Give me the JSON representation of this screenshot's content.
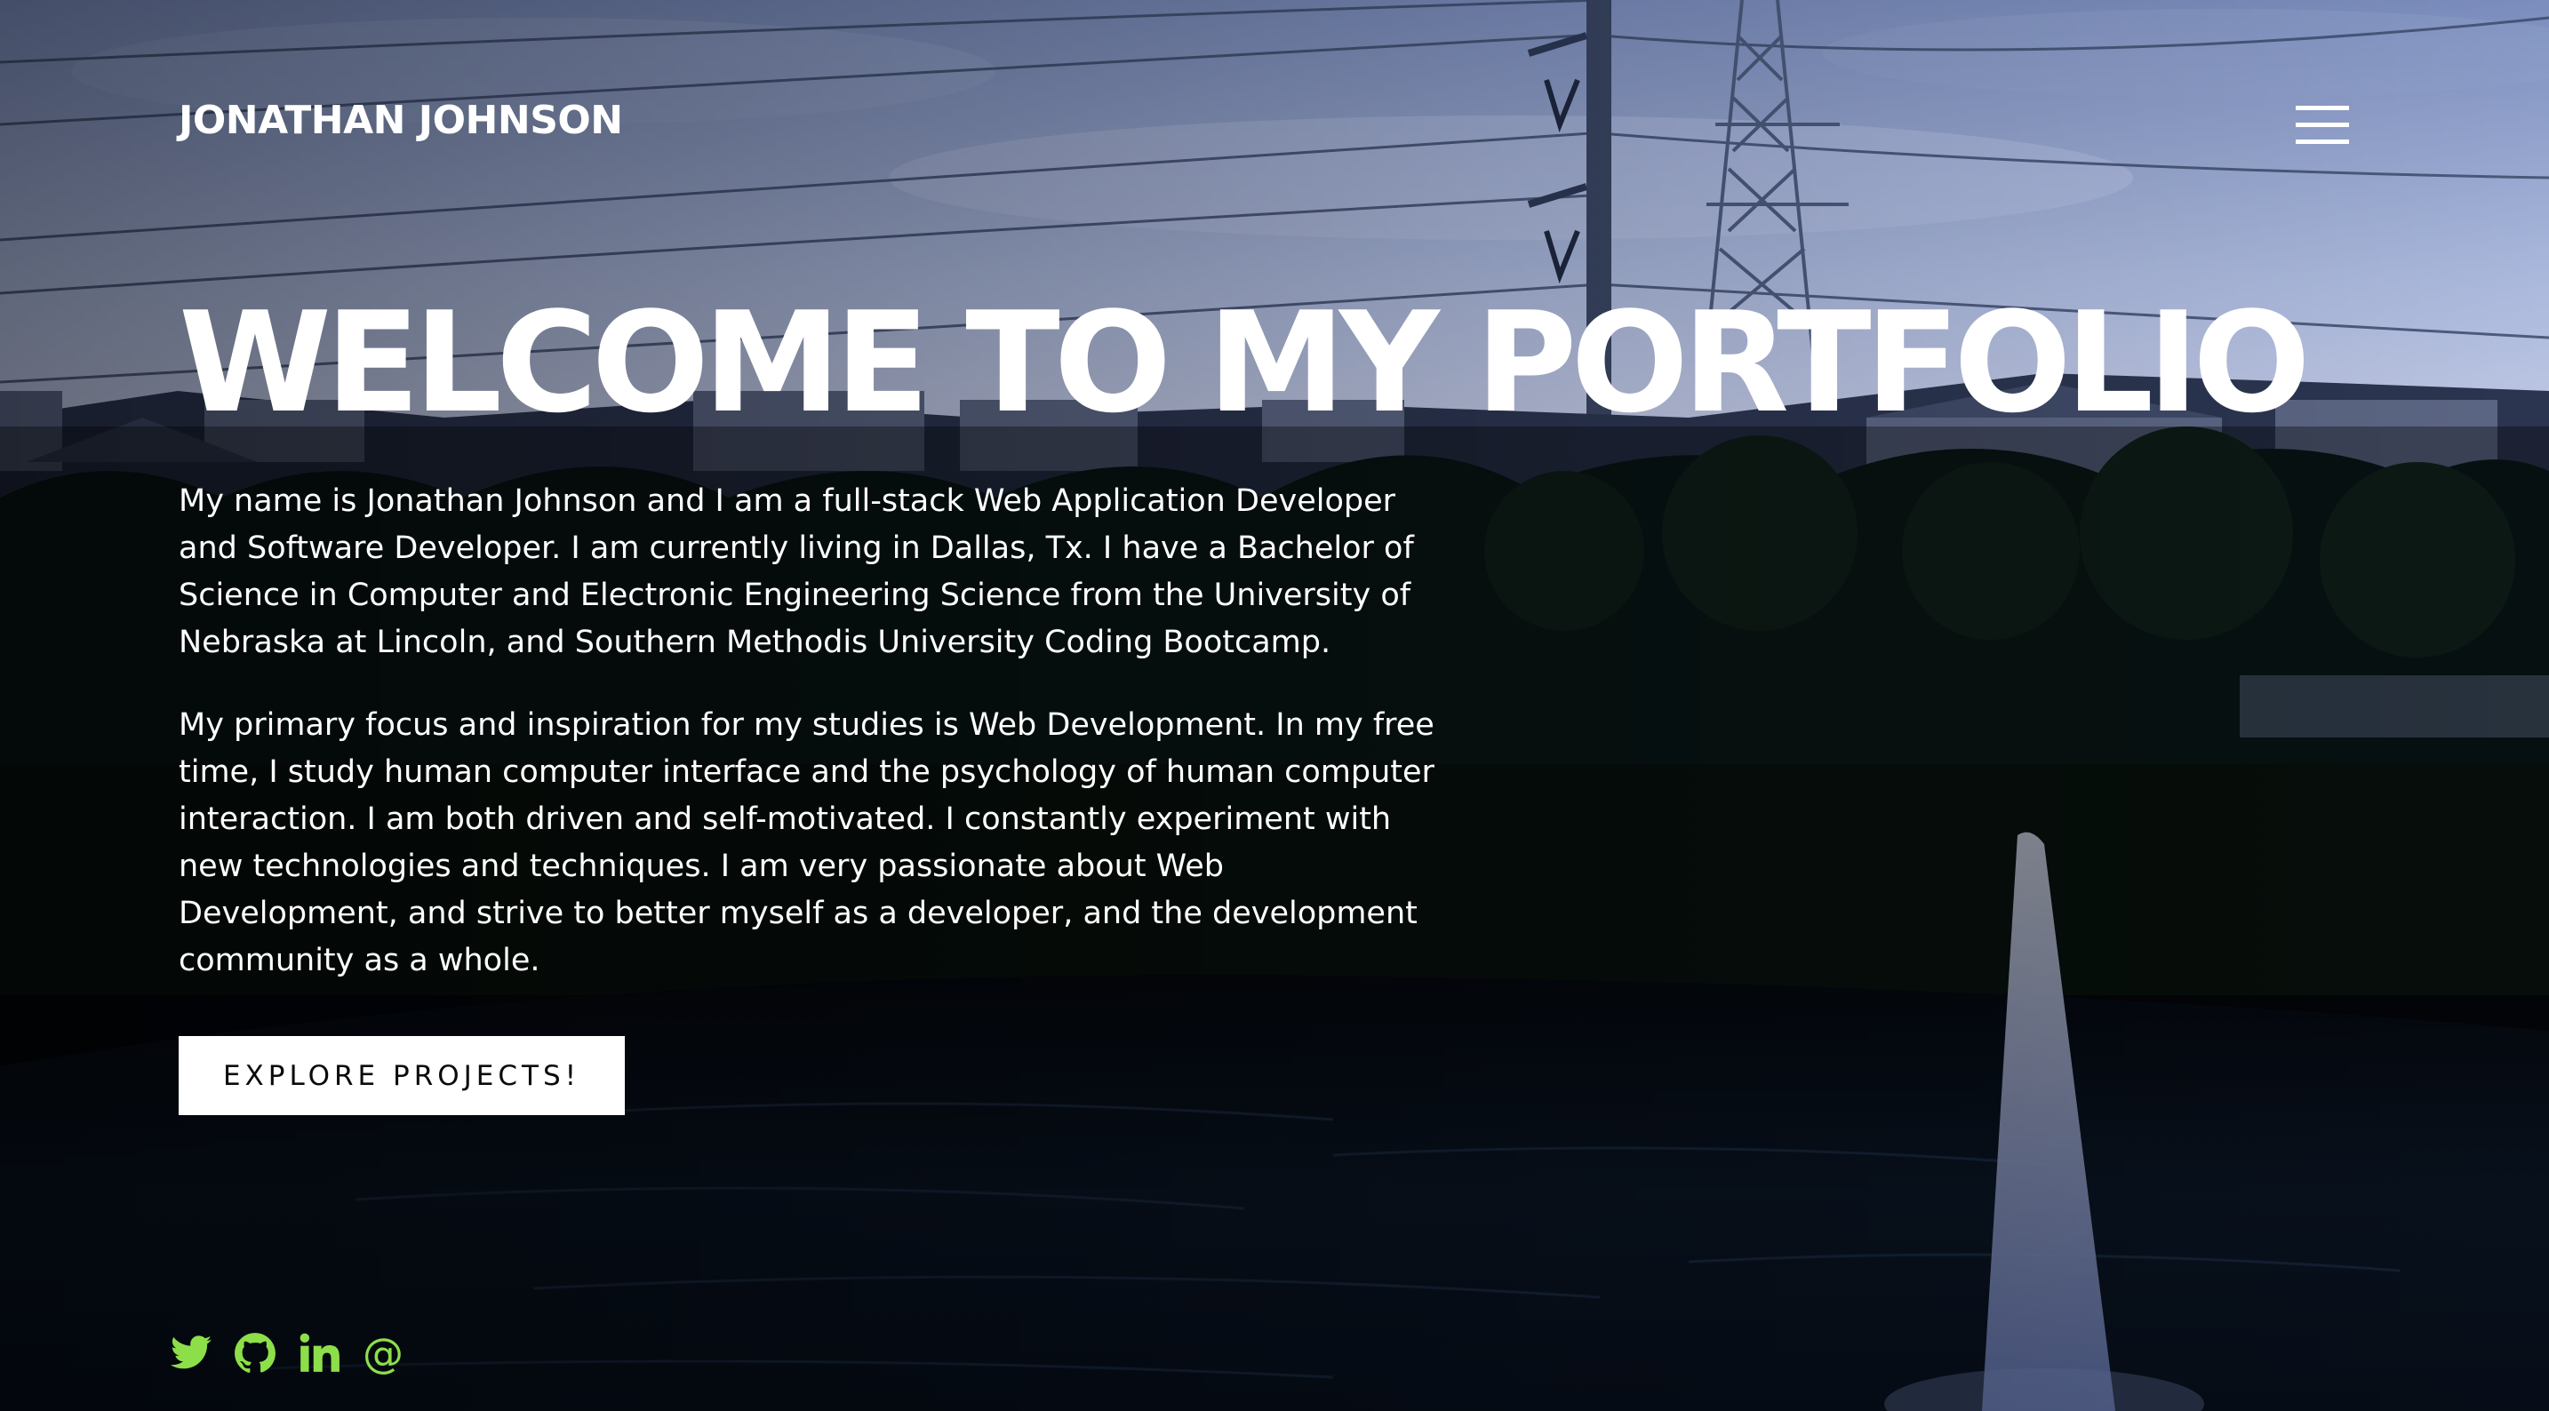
{
  "header": {
    "logo_text": "JONATHAN JOHNSON",
    "menu_icon": "hamburger-menu-icon"
  },
  "hero": {
    "headline": "WELCOME TO MY PORTFOLIO",
    "paragraphs": [
      "My name is Jonathan Johnson and I am a full-stack Web Application Developer and Software Developer. I am currently living in Dallas, Tx. I have a Bachelor of Science in Computer and Electronic Engineering Science from the University of Nebraska at Lincoln, and Southern Methodis University Coding Bootcamp.",
      "My primary focus and inspiration for my studies is Web Development. In my free time, I study human computer interface and the psychology of human computer interaction. I am both driven and self-motivated. I constantly experiment with new technologies and techniques. I am very passionate about Web Development, and strive to better myself as a developer, and the development community as a whole."
    ],
    "cta_label": "EXPLORE PROJECTS!"
  },
  "social": {
    "icons": [
      "twitter-icon",
      "github-icon",
      "linkedin-icon",
      "email-icon"
    ],
    "email_glyph": "@"
  },
  "colors": {
    "accent": "#8ddf4a",
    "text": "#ffffff",
    "button_bg": "#ffffff",
    "button_text": "#0b0b0b"
  }
}
